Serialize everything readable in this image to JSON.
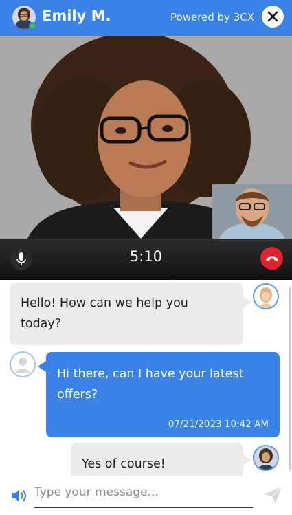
{
  "header": {
    "agent_name": "Emily M.",
    "powered_by": "Powered by 3CX",
    "status": "online",
    "close_icon": "close-icon",
    "accent": "#3a82e6"
  },
  "call": {
    "timer": "5:10",
    "mic_icon": "microphone-icon",
    "hangup_icon": "phone-hangup-icon",
    "hangup_color": "#e0232c"
  },
  "messages": [
    {
      "sender": "agent",
      "text": "Hello! How can we help you today?"
    },
    {
      "sender": "user",
      "text": "Hi there, can I have your latest offers?",
      "timestamp": "07/21/2023 10:42 AM"
    },
    {
      "sender": "agent",
      "text": "Yes of course!"
    }
  ],
  "composer": {
    "placeholder": "Type your message...",
    "value": "",
    "sound_icon": "speaker-icon",
    "send_icon": "send-icon"
  }
}
